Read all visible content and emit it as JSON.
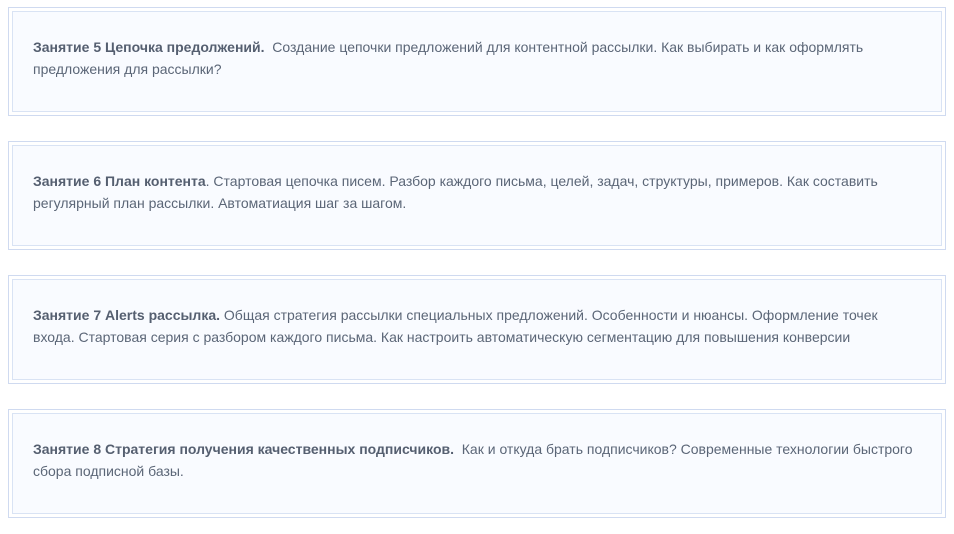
{
  "lessons": [
    {
      "title": "Занятие 5 Цепочка предолжений.",
      "description": "Создание цепочки предложений для контентной рассылки. Как выбирать и как оформлять предложения для рассылки?"
    },
    {
      "title": "Занятие 6  План контента",
      "description": ". Стартовая цепочка писем. Разбор каждого письма, целей, задач, структуры, примеров.  Как составить регулярный план рассылки. Автоматиация шаг за шагом."
    },
    {
      "title": "Занятие 7 Alerts рассылка.",
      "description": "Общая стратегия рассылки специальных предложений.  Особенности и нюансы. Оформление точек входа. Стартовая серия с разбором каждого письма. Как настроить автоматическую сегментацию для повышения конверсии"
    },
    {
      "title": "Занятие 8 Стратегия получения качественных подписчиков.",
      "description": "Как и откуда брать подписчиков? Современные технологии быстрого сбора подписной базы."
    }
  ]
}
